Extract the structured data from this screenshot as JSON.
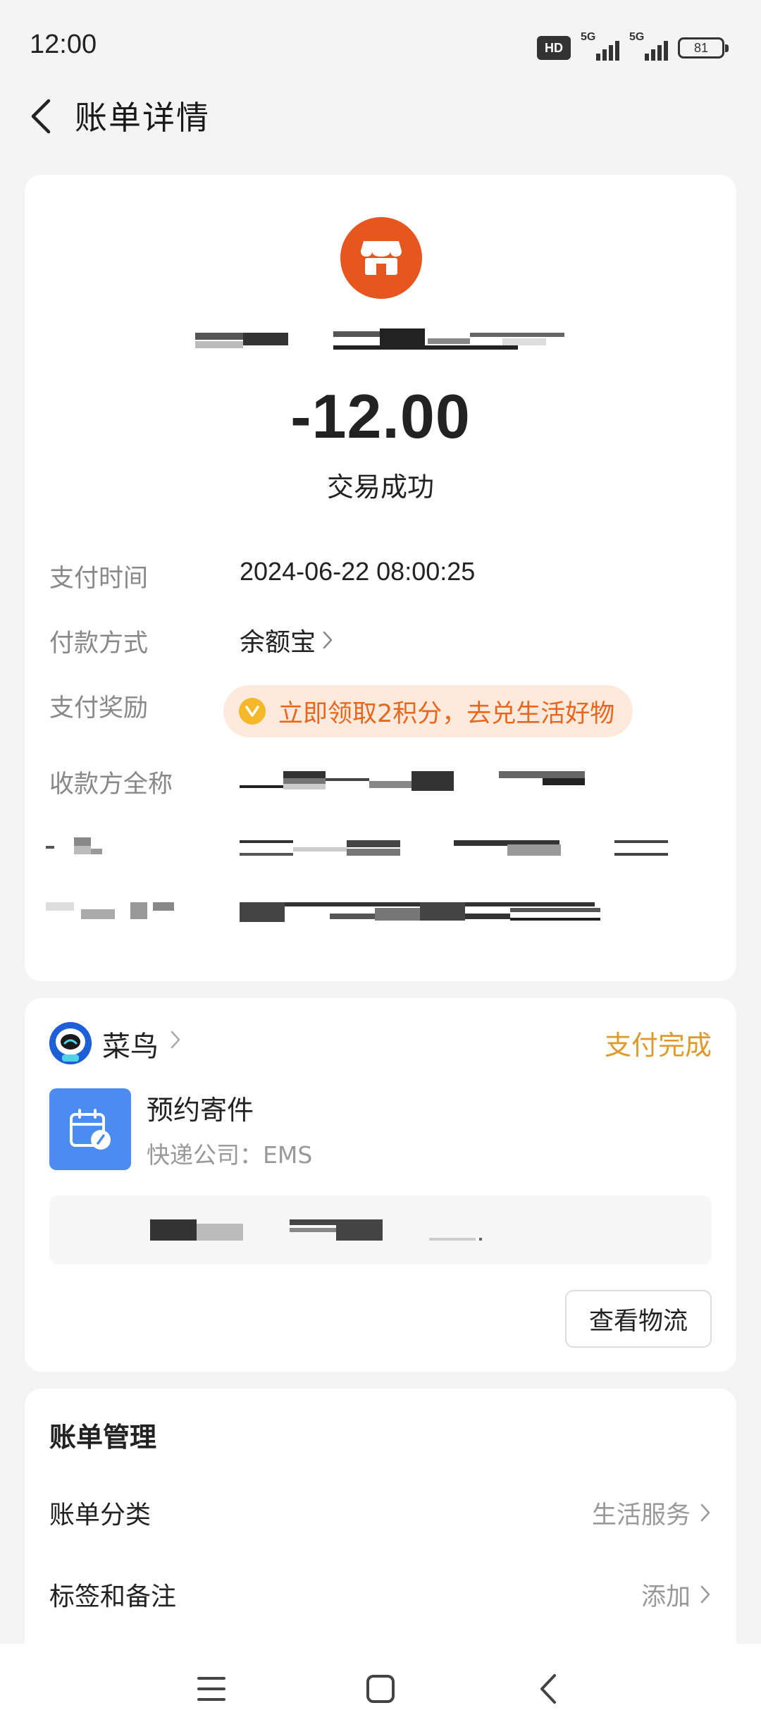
{
  "status_bar": {
    "time": "12:00",
    "hd": "HD",
    "sim1": "5G",
    "sim2": "5G",
    "battery": "81"
  },
  "header": {
    "title": "账单详情"
  },
  "bill": {
    "amount": "-12.00",
    "status": "交易成功",
    "rows": {
      "pay_time": {
        "label": "支付时间",
        "value": "2024-06-22 08:00:25"
      },
      "pay_method": {
        "label": "付款方式",
        "value": "余额宝"
      },
      "reward": {
        "label": "支付奖励",
        "value": "立即领取2积分，去兑生活好物"
      },
      "payee": {
        "label": "收款方全称"
      }
    },
    "colors": {
      "merchant_logo": "#e8561f",
      "reward_text": "#e8671f",
      "reward_bg": "#fdeadc"
    }
  },
  "cainiao": {
    "name": "菜鸟",
    "status": "支付完成",
    "service_title": "预约寄件",
    "service_sub": "快递公司：EMS",
    "logistics_button": "查看物流",
    "colors": {
      "status": "#e09a2c",
      "service_icon": "#4b8cf0"
    }
  },
  "manage": {
    "title": "账单管理",
    "items": [
      {
        "label": "账单分类",
        "value": "生活服务"
      },
      {
        "label": "标签和备注",
        "value": "添加"
      }
    ]
  },
  "icons": {
    "back": "chevron-left-icon",
    "merchant": "store-icon",
    "coin": "coin-icon",
    "cainiao_logo": "cainiao-logo",
    "service": "calendar-edit-icon",
    "chevron": "chevron-right-icon",
    "nav_menu": "menu-icon",
    "nav_home": "home-square-icon",
    "nav_back": "back-triangle-icon"
  }
}
